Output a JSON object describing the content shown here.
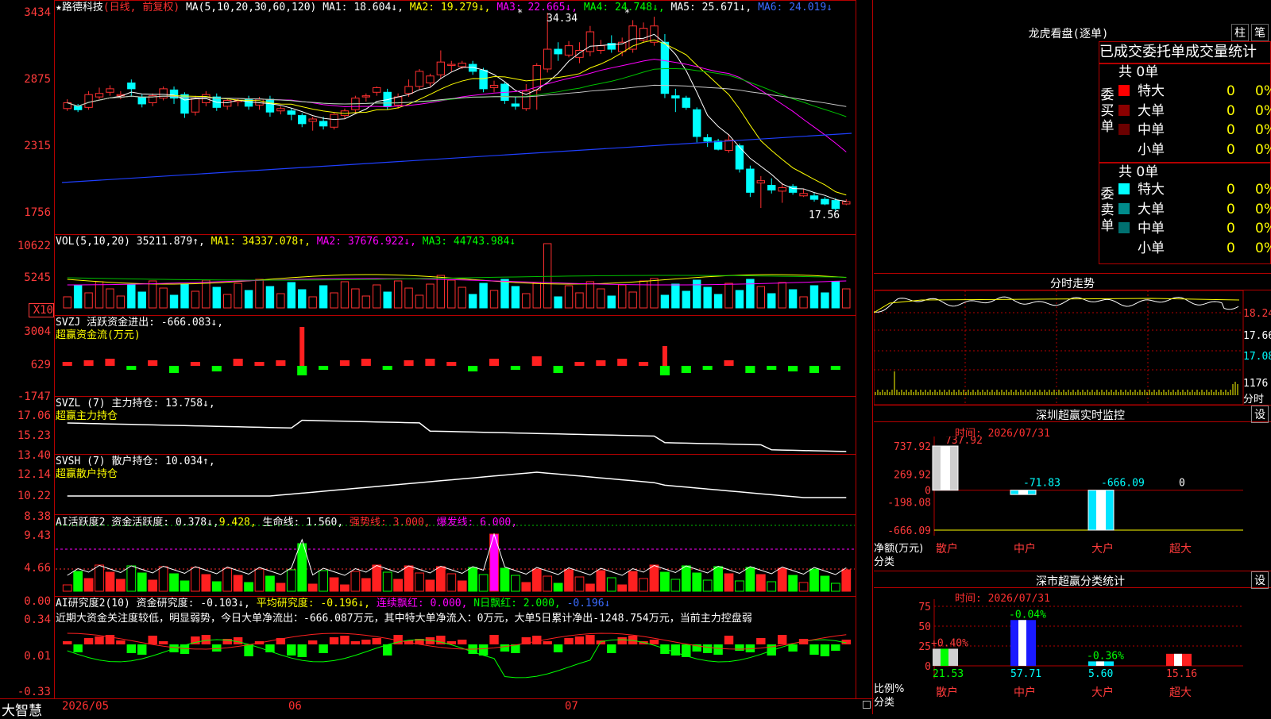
{
  "stock": {
    "star": "★",
    "name": "路德科技",
    "mode": "(日线, 前复权)"
  },
  "kline": {
    "ma_header": "MA(5,10,20,30,60,120)",
    "ma1": "MA1: 18.604↓,",
    "ma2": "MA2: 19.279↓,",
    "ma3": "MA3: 22.665↓,",
    "ma4": "MA4: 24.748↓,",
    "ma5": "MA5: 25.671↓,",
    "ma6": "MA6: 24.019↓",
    "y_labels": [
      "3434",
      "2875",
      "2315",
      "1756"
    ],
    "high_label": "34.34",
    "low_label": "17.56",
    "candles": [
      {
        "o": 26.1,
        "c": 26.6,
        "h": 26.9,
        "l": 25.9
      },
      {
        "o": 26.3,
        "c": 26.0,
        "h": 26.5,
        "l": 25.8
      },
      {
        "o": 26.2,
        "c": 27.3,
        "h": 27.6,
        "l": 26.0
      },
      {
        "o": 27.1,
        "c": 27.4,
        "h": 27.9,
        "l": 26.9
      },
      {
        "o": 27.5,
        "c": 27.8,
        "h": 28.1,
        "l": 27.2
      },
      {
        "o": 27.2,
        "c": 27.3,
        "h": 27.6,
        "l": 26.9
      },
      {
        "o": 28.3,
        "c": 27.8,
        "h": 28.6,
        "l": 27.1
      },
      {
        "o": 27.1,
        "c": 26.5,
        "h": 27.3,
        "l": 26.2
      },
      {
        "o": 26.6,
        "c": 27.2,
        "h": 27.4,
        "l": 26.3
      },
      {
        "o": 27.0,
        "c": 27.8,
        "h": 28.0,
        "l": 26.8
      },
      {
        "o": 27.7,
        "c": 27.0,
        "h": 28.0,
        "l": 26.5
      },
      {
        "o": 27.3,
        "c": 25.7,
        "h": 27.5,
        "l": 25.3
      },
      {
        "o": 25.8,
        "c": 27.0,
        "h": 27.2,
        "l": 25.5
      },
      {
        "o": 26.6,
        "c": 27.3,
        "h": 27.6,
        "l": 26.3
      },
      {
        "o": 27.1,
        "c": 26.2,
        "h": 27.4,
        "l": 25.9
      },
      {
        "o": 26.3,
        "c": 26.8,
        "h": 27.0,
        "l": 26.0
      },
      {
        "o": 26.7,
        "c": 26.8,
        "h": 27.0,
        "l": 26.3
      },
      {
        "o": 26.9,
        "c": 26.3,
        "h": 27.2,
        "l": 26.0
      },
      {
        "o": 26.4,
        "c": 26.9,
        "h": 27.1,
        "l": 26.0
      },
      {
        "o": 26.9,
        "c": 25.8,
        "h": 27.2,
        "l": 25.4
      },
      {
        "o": 25.9,
        "c": 26.1,
        "h": 26.3,
        "l": 25.6
      },
      {
        "o": 25.9,
        "c": 25.6,
        "h": 26.1,
        "l": 25.1
      },
      {
        "o": 25.5,
        "c": 24.8,
        "h": 25.7,
        "l": 24.5
      },
      {
        "o": 25.0,
        "c": 25.2,
        "h": 25.4,
        "l": 24.2
      },
      {
        "o": 25.0,
        "c": 24.6,
        "h": 25.4,
        "l": 24.3
      },
      {
        "o": 24.5,
        "c": 25.6,
        "h": 25.8,
        "l": 24.3
      },
      {
        "o": 25.5,
        "c": 25.9,
        "h": 26.1,
        "l": 25.2
      },
      {
        "o": 26.0,
        "c": 27.0,
        "h": 27.2,
        "l": 25.7
      },
      {
        "o": 27.1,
        "c": 27.2,
        "h": 27.4,
        "l": 26.7
      },
      {
        "o": 27.5,
        "c": 27.9,
        "h": 28.0,
        "l": 27.2
      },
      {
        "o": 27.5,
        "c": 26.3,
        "h": 27.8,
        "l": 26.0
      },
      {
        "o": 26.4,
        "c": 27.1,
        "h": 27.4,
        "l": 26.1
      },
      {
        "o": 27.4,
        "c": 28.0,
        "h": 28.6,
        "l": 27.1
      },
      {
        "o": 28.0,
        "c": 29.3,
        "h": 29.5,
        "l": 27.7
      },
      {
        "o": 28.3,
        "c": 28.9,
        "h": 29.1,
        "l": 28.0
      },
      {
        "o": 29.0,
        "c": 30.1,
        "h": 31.1,
        "l": 28.7
      },
      {
        "o": 29.8,
        "c": 29.9,
        "h": 30.2,
        "l": 29.3
      },
      {
        "o": 29.7,
        "c": 30.0,
        "h": 30.2,
        "l": 29.5
      },
      {
        "o": 29.9,
        "c": 29.3,
        "h": 30.2,
        "l": 29.0
      },
      {
        "o": 29.4,
        "c": 27.8,
        "h": 29.6,
        "l": 27.5
      },
      {
        "o": 27.9,
        "c": 28.1,
        "h": 28.5,
        "l": 27.5
      },
      {
        "o": 28.2,
        "c": 26.8,
        "h": 28.4,
        "l": 26.5
      },
      {
        "o": 26.5,
        "c": 26.3,
        "h": 27.1,
        "l": 26.0
      },
      {
        "o": 26.1,
        "c": 27.6,
        "h": 28.2,
        "l": 25.9
      },
      {
        "o": 27.7,
        "c": 29.8,
        "h": 30.0,
        "l": 26.0
      },
      {
        "o": 29.5,
        "c": 31.2,
        "h": 34.34,
        "l": 29.2
      },
      {
        "o": 31.2,
        "c": 30.8,
        "h": 31.8,
        "l": 30.2
      },
      {
        "o": 30.7,
        "c": 31.5,
        "h": 31.9,
        "l": 30.5
      },
      {
        "o": 30.5,
        "c": 31.1,
        "h": 31.8,
        "l": 30.0
      },
      {
        "o": 31.0,
        "c": 32.7,
        "h": 33.2,
        "l": 30.6
      },
      {
        "o": 31.1,
        "c": 31.5,
        "h": 32.0,
        "l": 30.8
      },
      {
        "o": 31.7,
        "c": 31.2,
        "h": 32.4,
        "l": 30.9
      },
      {
        "o": 31.0,
        "c": 31.8,
        "h": 32.2,
        "l": 30.6
      },
      {
        "o": 31.2,
        "c": 33.2,
        "h": 33.7,
        "l": 30.9
      },
      {
        "o": 32.0,
        "c": 33.0,
        "h": 33.5,
        "l": 31.8
      },
      {
        "o": 31.8,
        "c": 33.2,
        "h": 34.0,
        "l": 31.5
      },
      {
        "o": 31.8,
        "c": 27.4,
        "h": 32.5,
        "l": 27.0
      },
      {
        "o": 27.2,
        "c": 27.0,
        "h": 27.8,
        "l": 25.8
      },
      {
        "o": 27.0,
        "c": 26.2,
        "h": 27.2,
        "l": 26.0
      },
      {
        "o": 26.0,
        "c": 23.7,
        "h": 26.2,
        "l": 23.2
      },
      {
        "o": 23.6,
        "c": 23.3,
        "h": 23.9,
        "l": 22.8
      },
      {
        "o": 23.3,
        "c": 22.6,
        "h": 23.5,
        "l": 22.5
      },
      {
        "o": 22.5,
        "c": 23.4,
        "h": 23.9,
        "l": 22.3
      },
      {
        "o": 22.9,
        "c": 20.9,
        "h": 23.1,
        "l": 20.6
      },
      {
        "o": 20.9,
        "c": 18.9,
        "h": 21.2,
        "l": 18.5
      },
      {
        "o": 19.7,
        "c": 19.9,
        "h": 20.3,
        "l": 17.56
      },
      {
        "o": 19.5,
        "c": 19.1,
        "h": 20.1,
        "l": 18.8
      },
      {
        "o": 19.0,
        "c": 19.3,
        "h": 19.7,
        "l": 18.0
      },
      {
        "o": 19.4,
        "c": 18.9,
        "h": 19.6,
        "l": 18.7
      },
      {
        "o": 18.6,
        "c": 18.8,
        "h": 19.2,
        "l": 18.5
      },
      {
        "o": 18.6,
        "c": 18.3,
        "h": 18.9,
        "l": 18.1
      },
      {
        "o": 18.3,
        "c": 17.9,
        "h": 18.5,
        "l": 17.8
      },
      {
        "o": 18.2,
        "c": 17.5,
        "h": 18.4,
        "l": 17.3
      },
      {
        "o": 17.9,
        "c": 18.1,
        "h": 18.3,
        "l": 17.8
      }
    ]
  },
  "vol": {
    "header": "VOL(5,10,20)",
    "value": "35211.879↑,",
    "ma1": "MA1: 34337.078↑,",
    "ma2": "MA2: 37676.922↓,",
    "ma3": "MA3: 44743.984↓",
    "y_labels": [
      "10622",
      "5245",
      "X10"
    ]
  },
  "svzj": {
    "header": "SVZJ  活跃资金进出: -666.083↓,",
    "sub": "超赢资金流(万元)",
    "y_labels": [
      "3004",
      "629",
      "-1747"
    ]
  },
  "svzl": {
    "header": "SVZL (7) 主力持仓: 13.758↓,",
    "sub": "超赢主力持仓",
    "y_labels": [
      "17.06",
      "15.23",
      "13.40"
    ]
  },
  "svsh": {
    "header": "SVSH (7) 散户持仓: 10.034↑,",
    "sub": "超赢散户持仓",
    "y_labels": [
      "12.14",
      "10.22",
      "8.38"
    ]
  },
  "ai1": {
    "header": "AI活跃度2 资金活跃度: 0.378↓,",
    "v2": "9.428,",
    "life": "生命线: 1.560,",
    "strong": "强势线: 3.000,",
    "burst": "爆发线: 6.000,",
    "y_labels": [
      "9.43",
      "4.66",
      "0.00"
    ]
  },
  "ai2": {
    "header": "AI研究度2(10) 资金研究度: -0.103↓,",
    "avg": "平均研究度: -0.196↓,",
    "lian": "连续飘红: 0.000,",
    "nday": "N日飘红: 2.000,",
    "last": "-0.196↓",
    "comment": "近期大资金关注度较低，明显弱势，今日大单净流出：-666.087万元，其中特大单净流入：0万元，大单5日累计净出-1248.754万元，当前主力控盘弱",
    "y_labels": [
      "0.34",
      "0.01",
      "-0.33"
    ]
  },
  "xaxis": {
    "brand": "大智慧",
    "labels": [
      "2026/05",
      "06",
      "07"
    ]
  },
  "longhu": {
    "title": "龙虎看盘(逐单)",
    "btn1": "柱",
    "btn2": "笔",
    "tabs": [
      "已成交",
      "委托单",
      "成交量",
      "统计"
    ],
    "buy": {
      "side": "委买单",
      "total": "共 0单",
      "rows": [
        {
          "name": "特大",
          "color": "#ff0000",
          "v": "0",
          "p": "0%"
        },
        {
          "name": "大单",
          "color": "#8b0000",
          "v": "0",
          "p": "0%"
        },
        {
          "name": "中单",
          "color": "#6b0000",
          "v": "0",
          "p": "0%"
        },
        {
          "name": "小单",
          "color": "#000000",
          "v": "0",
          "p": "0%"
        }
      ]
    },
    "sell": {
      "side": "委卖单",
      "total": "共 0单",
      "rows": [
        {
          "name": "特大",
          "color": "#00ffff",
          "v": "0",
          "p": "0%"
        },
        {
          "name": "大单",
          "color": "#008b8b",
          "v": "0",
          "p": "0%"
        },
        {
          "name": "中单",
          "color": "#007070",
          "v": "0",
          "p": "0%"
        },
        {
          "name": "小单",
          "color": "#000000",
          "v": "0",
          "p": "0%"
        }
      ]
    }
  },
  "intraday": {
    "title": "分时走势",
    "y_labels": [
      "18.24",
      "17.66",
      "17.08",
      "1176",
      "分时"
    ]
  },
  "monitor": {
    "title": "深圳超赢实时监控",
    "btn": "设",
    "time": "时间: 2026/07/31",
    "y_labels": [
      "737.92",
      "269.92",
      "0",
      "-198.08",
      "-666.09"
    ],
    "ylabel": "净额(万元)",
    "xlabel": "分类",
    "categories": [
      "散户",
      "中户",
      "大户",
      "超大"
    ],
    "values": [
      737.92,
      -71.83,
      -666.09,
      0
    ],
    "value_labels": [
      "737.92",
      "-71.83",
      "-666.09",
      "0"
    ]
  },
  "classify": {
    "title": "深市超赢分类统计",
    "btn": "设",
    "time": "时间: 2026/07/31",
    "y_labels": [
      "75",
      "50",
      "25",
      "0"
    ],
    "ylabel": "比例%",
    "xlabel": "分类",
    "categories": [
      "散户",
      "中户",
      "大户",
      "超大"
    ],
    "values": [
      21.53,
      57.71,
      5.6,
      15.16
    ],
    "value_labels": [
      "21.53",
      "57.71",
      "5.60",
      "15.16"
    ],
    "change_labels": [
      "+0.40%",
      "-0.04%",
      "-0.36%",
      ""
    ]
  },
  "chart_data": [
    {
      "type": "bar",
      "title": "深圳超赢实时监控",
      "categories": [
        "散户",
        "中户",
        "大户",
        "超大"
      ],
      "values": [
        737.92,
        -71.83,
        -666.09,
        0
      ],
      "ylabel": "净额(万元)",
      "xlabel": "分类",
      "ylim": [
        -666.09,
        737.92
      ]
    },
    {
      "type": "bar",
      "title": "深市超赢分类统计",
      "categories": [
        "散户",
        "中户",
        "大户",
        "超大"
      ],
      "values": [
        21.53,
        57.71,
        5.6,
        15.16
      ],
      "ylabel": "比例%",
      "xlabel": "分类",
      "ylim": [
        0,
        75
      ]
    }
  ]
}
